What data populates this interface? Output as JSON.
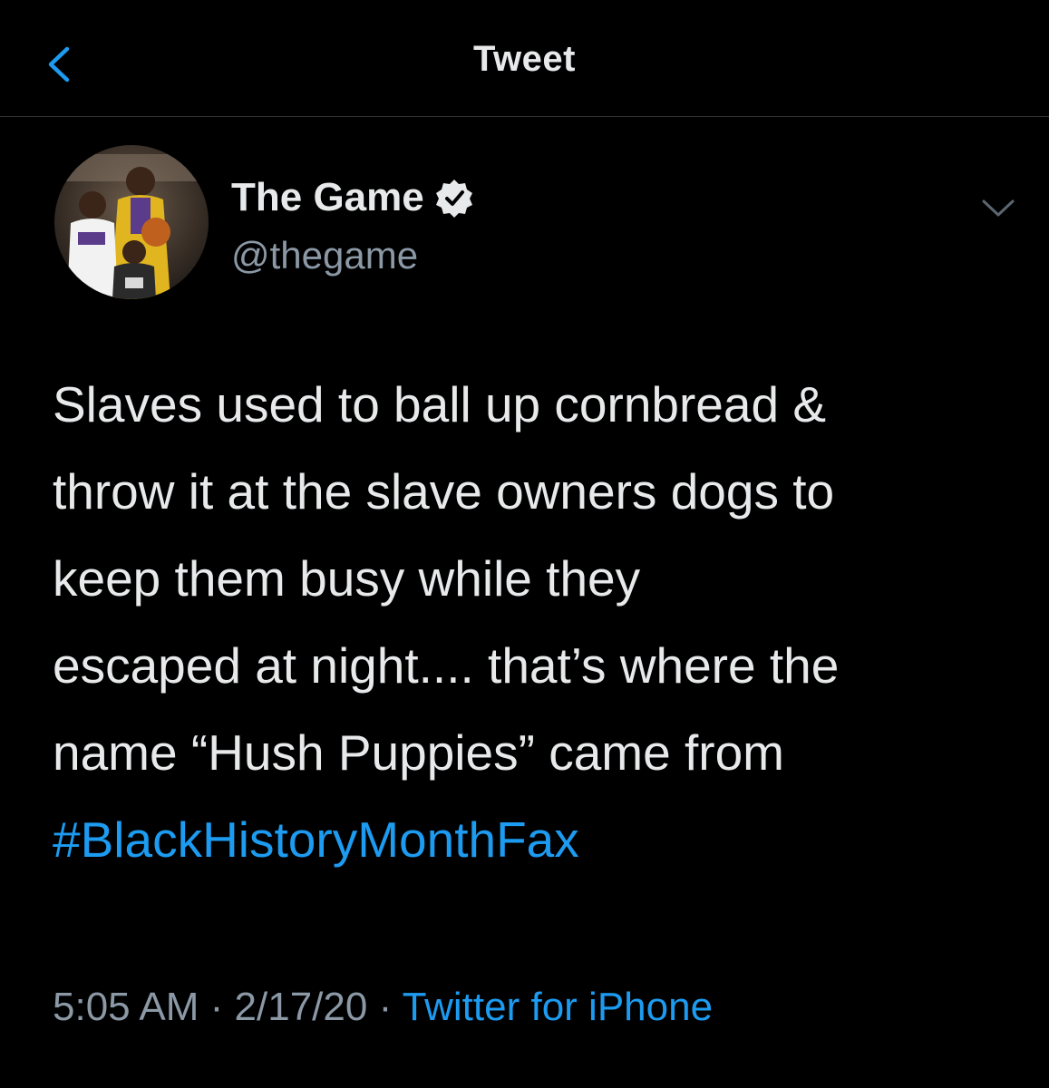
{
  "header": {
    "title": "Tweet",
    "back_icon": "chevron-left-icon"
  },
  "author": {
    "display_name": "The Game",
    "handle": "@thegame",
    "verified": true,
    "verified_icon": "verified-badge-icon",
    "menu_icon": "chevron-down-icon"
  },
  "tweet": {
    "lines": [
      "Slaves used to ball up cornbread &",
      "throw it at the slave owners dogs to",
      "keep them busy while they",
      "escaped at night.... that’s where the",
      "name “Hush Puppies” came from"
    ],
    "hashtag": "#BlackHistoryMonthFax"
  },
  "meta": {
    "time": "5:05 AM",
    "separator": " · ",
    "date": "2/17/20",
    "source": "Twitter for iPhone"
  },
  "colors": {
    "background": "#000000",
    "text": "#e7e9ea",
    "secondary": "#8b98a5",
    "accent": "#1d9bf0",
    "divider": "#2f3336"
  }
}
